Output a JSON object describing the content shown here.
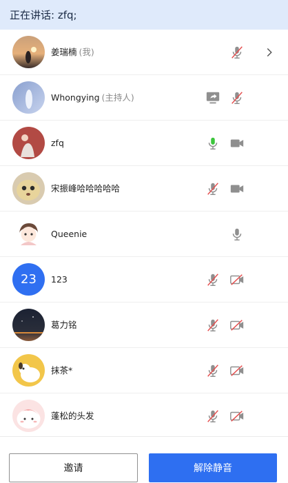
{
  "speaking_bar": {
    "text": "正在讲话: zfq;"
  },
  "participants": [
    {
      "name": "姜瑞楠",
      "tag": "(我)"
    },
    {
      "name": "Whongying",
      "tag": "(主持人)"
    },
    {
      "name": "zfq",
      "tag": ""
    },
    {
      "name": "宋振峰哈哈哈哈哈",
      "tag": ""
    },
    {
      "name": "Queenie",
      "tag": ""
    },
    {
      "name": "123",
      "tag": "",
      "avatar_text": "23"
    },
    {
      "name": "葛力铭",
      "tag": ""
    },
    {
      "name": "抹茶*",
      "tag": ""
    },
    {
      "name": "蓬松的头发",
      "tag": ""
    }
  ],
  "footer": {
    "invite_label": "邀请",
    "unmute_label": "解除静音"
  },
  "colors": {
    "accent": "#2e6ff1",
    "speaking_bg": "#dfeafb",
    "mic_active": "#3cc53c",
    "muted_slash": "#e55050"
  }
}
